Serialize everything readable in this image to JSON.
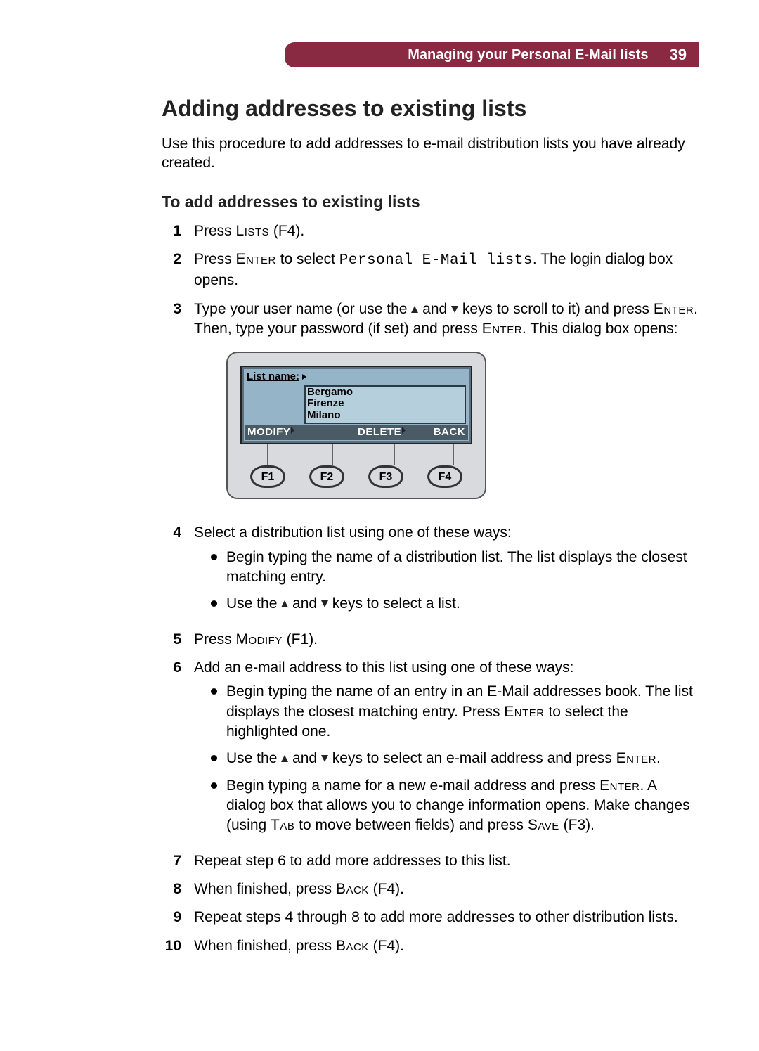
{
  "header": {
    "title": "Managing your Personal E-Mail lists",
    "page": "39"
  },
  "h1": "Adding addresses to existing lists",
  "intro": "Use this procedure to add addresses to e-mail distribution lists you have already created.",
  "h2": "To add addresses to existing lists",
  "keys": {
    "lists": "Lists",
    "enter": "Enter",
    "modify": "Modify",
    "back": "Back",
    "tab": "Tab",
    "save": "Save"
  },
  "fn": {
    "f1": "F1",
    "f2": "F2",
    "f3": "F3",
    "f4": "F4"
  },
  "mono": {
    "personal": "Personal E-Mail lists"
  },
  "steps": {
    "s1a": "Press ",
    "s1b": " (",
    "s1c": ").",
    "s2a": "Press ",
    "s2b": " to select ",
    "s2c": ". The login dialog box opens.",
    "s3a": "Type your user name (or use the ",
    "s3b": " and ",
    "s3c": " keys to scroll to it) and press ",
    "s3d": ". Then, type your password (if set) and press ",
    "s3e": ". This dialog box opens:",
    "s4": "Select a distribution list using one of these ways:",
    "s4b1": "Begin typing the name of a distribution list. The list displays the closest matching entry.",
    "s4b2a": "Use the ",
    "s4b2b": " and ",
    "s4b2c": " keys to select a list.",
    "s5a": "Press ",
    "s5b": " (",
    "s5c": ").",
    "s6": "Add an e-mail address to this list using one of these ways:",
    "s6b1a": "Begin typing the name of an entry in an E-Mail addresses book. The list displays the closest matching entry. Press ",
    "s6b1b": " to select the highlighted one.",
    "s6b2a": "Use the ",
    "s6b2b": " and ",
    "s6b2c": " keys to select an e-mail address and press ",
    "s6b2d": ".",
    "s6b3a": "Begin typing a name for a new e-mail address and press ",
    "s6b3b": ". A dialog box that allows you to change information opens. Make changes (using ",
    "s6b3c": " to move between fields) and press ",
    "s6b3d": " (",
    "s6b3e": ").",
    "s7": "Repeat step 6 to add more addresses to this list.",
    "s8a": "When finished, press ",
    "s8b": " (",
    "s8c": ").",
    "s9": "Repeat steps 4 through 8 to add more addresses to other distribution lists.",
    "s10a": "When finished, press ",
    "s10b": " (",
    "s10c": ")."
  },
  "nums": {
    "n1": "1",
    "n2": "2",
    "n3": "3",
    "n4": "4",
    "n5": "5",
    "n6": "6",
    "n7": "7",
    "n8": "8",
    "n9": "9",
    "n10": "10"
  },
  "dialog": {
    "label": "List name:",
    "items": {
      "i1": "Bergamo",
      "i2": "Firenze",
      "i3": "Milano"
    },
    "soft": {
      "modify": "MODIFY",
      "delete": "DELETE",
      "back": "BACK"
    },
    "fkeys": {
      "f1": "F1",
      "f2": "F2",
      "f3": "F3",
      "f4": "F4"
    }
  }
}
